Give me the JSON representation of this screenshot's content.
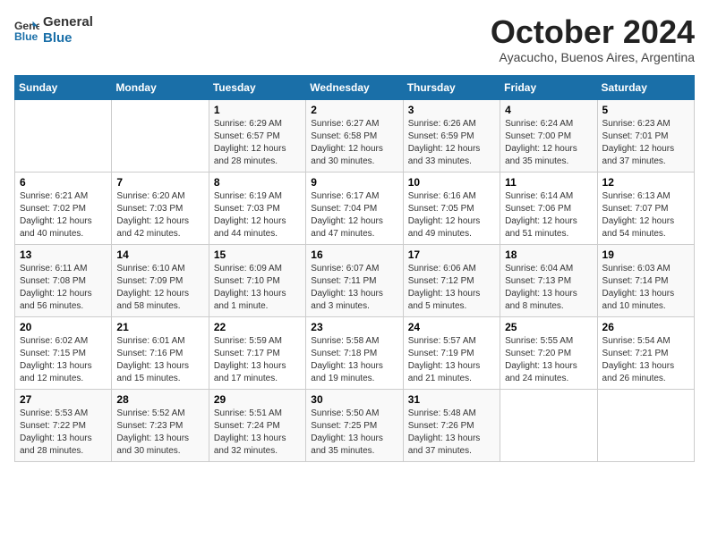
{
  "header": {
    "logo_line1": "General",
    "logo_line2": "Blue",
    "month": "October 2024",
    "location": "Ayacucho, Buenos Aires, Argentina"
  },
  "days_of_week": [
    "Sunday",
    "Monday",
    "Tuesday",
    "Wednesday",
    "Thursday",
    "Friday",
    "Saturday"
  ],
  "weeks": [
    [
      {
        "day": "",
        "info": ""
      },
      {
        "day": "",
        "info": ""
      },
      {
        "day": "1",
        "info": "Sunrise: 6:29 AM\nSunset: 6:57 PM\nDaylight: 12 hours\nand 28 minutes."
      },
      {
        "day": "2",
        "info": "Sunrise: 6:27 AM\nSunset: 6:58 PM\nDaylight: 12 hours\nand 30 minutes."
      },
      {
        "day": "3",
        "info": "Sunrise: 6:26 AM\nSunset: 6:59 PM\nDaylight: 12 hours\nand 33 minutes."
      },
      {
        "day": "4",
        "info": "Sunrise: 6:24 AM\nSunset: 7:00 PM\nDaylight: 12 hours\nand 35 minutes."
      },
      {
        "day": "5",
        "info": "Sunrise: 6:23 AM\nSunset: 7:01 PM\nDaylight: 12 hours\nand 37 minutes."
      }
    ],
    [
      {
        "day": "6",
        "info": "Sunrise: 6:21 AM\nSunset: 7:02 PM\nDaylight: 12 hours\nand 40 minutes."
      },
      {
        "day": "7",
        "info": "Sunrise: 6:20 AM\nSunset: 7:03 PM\nDaylight: 12 hours\nand 42 minutes."
      },
      {
        "day": "8",
        "info": "Sunrise: 6:19 AM\nSunset: 7:03 PM\nDaylight: 12 hours\nand 44 minutes."
      },
      {
        "day": "9",
        "info": "Sunrise: 6:17 AM\nSunset: 7:04 PM\nDaylight: 12 hours\nand 47 minutes."
      },
      {
        "day": "10",
        "info": "Sunrise: 6:16 AM\nSunset: 7:05 PM\nDaylight: 12 hours\nand 49 minutes."
      },
      {
        "day": "11",
        "info": "Sunrise: 6:14 AM\nSunset: 7:06 PM\nDaylight: 12 hours\nand 51 minutes."
      },
      {
        "day": "12",
        "info": "Sunrise: 6:13 AM\nSunset: 7:07 PM\nDaylight: 12 hours\nand 54 minutes."
      }
    ],
    [
      {
        "day": "13",
        "info": "Sunrise: 6:11 AM\nSunset: 7:08 PM\nDaylight: 12 hours\nand 56 minutes."
      },
      {
        "day": "14",
        "info": "Sunrise: 6:10 AM\nSunset: 7:09 PM\nDaylight: 12 hours\nand 58 minutes."
      },
      {
        "day": "15",
        "info": "Sunrise: 6:09 AM\nSunset: 7:10 PM\nDaylight: 13 hours\nand 1 minute."
      },
      {
        "day": "16",
        "info": "Sunrise: 6:07 AM\nSunset: 7:11 PM\nDaylight: 13 hours\nand 3 minutes."
      },
      {
        "day": "17",
        "info": "Sunrise: 6:06 AM\nSunset: 7:12 PM\nDaylight: 13 hours\nand 5 minutes."
      },
      {
        "day": "18",
        "info": "Sunrise: 6:04 AM\nSunset: 7:13 PM\nDaylight: 13 hours\nand 8 minutes."
      },
      {
        "day": "19",
        "info": "Sunrise: 6:03 AM\nSunset: 7:14 PM\nDaylight: 13 hours\nand 10 minutes."
      }
    ],
    [
      {
        "day": "20",
        "info": "Sunrise: 6:02 AM\nSunset: 7:15 PM\nDaylight: 13 hours\nand 12 minutes."
      },
      {
        "day": "21",
        "info": "Sunrise: 6:01 AM\nSunset: 7:16 PM\nDaylight: 13 hours\nand 15 minutes."
      },
      {
        "day": "22",
        "info": "Sunrise: 5:59 AM\nSunset: 7:17 PM\nDaylight: 13 hours\nand 17 minutes."
      },
      {
        "day": "23",
        "info": "Sunrise: 5:58 AM\nSunset: 7:18 PM\nDaylight: 13 hours\nand 19 minutes."
      },
      {
        "day": "24",
        "info": "Sunrise: 5:57 AM\nSunset: 7:19 PM\nDaylight: 13 hours\nand 21 minutes."
      },
      {
        "day": "25",
        "info": "Sunrise: 5:55 AM\nSunset: 7:20 PM\nDaylight: 13 hours\nand 24 minutes."
      },
      {
        "day": "26",
        "info": "Sunrise: 5:54 AM\nSunset: 7:21 PM\nDaylight: 13 hours\nand 26 minutes."
      }
    ],
    [
      {
        "day": "27",
        "info": "Sunrise: 5:53 AM\nSunset: 7:22 PM\nDaylight: 13 hours\nand 28 minutes."
      },
      {
        "day": "28",
        "info": "Sunrise: 5:52 AM\nSunset: 7:23 PM\nDaylight: 13 hours\nand 30 minutes."
      },
      {
        "day": "29",
        "info": "Sunrise: 5:51 AM\nSunset: 7:24 PM\nDaylight: 13 hours\nand 32 minutes."
      },
      {
        "day": "30",
        "info": "Sunrise: 5:50 AM\nSunset: 7:25 PM\nDaylight: 13 hours\nand 35 minutes."
      },
      {
        "day": "31",
        "info": "Sunrise: 5:48 AM\nSunset: 7:26 PM\nDaylight: 13 hours\nand 37 minutes."
      },
      {
        "day": "",
        "info": ""
      },
      {
        "day": "",
        "info": ""
      }
    ]
  ]
}
